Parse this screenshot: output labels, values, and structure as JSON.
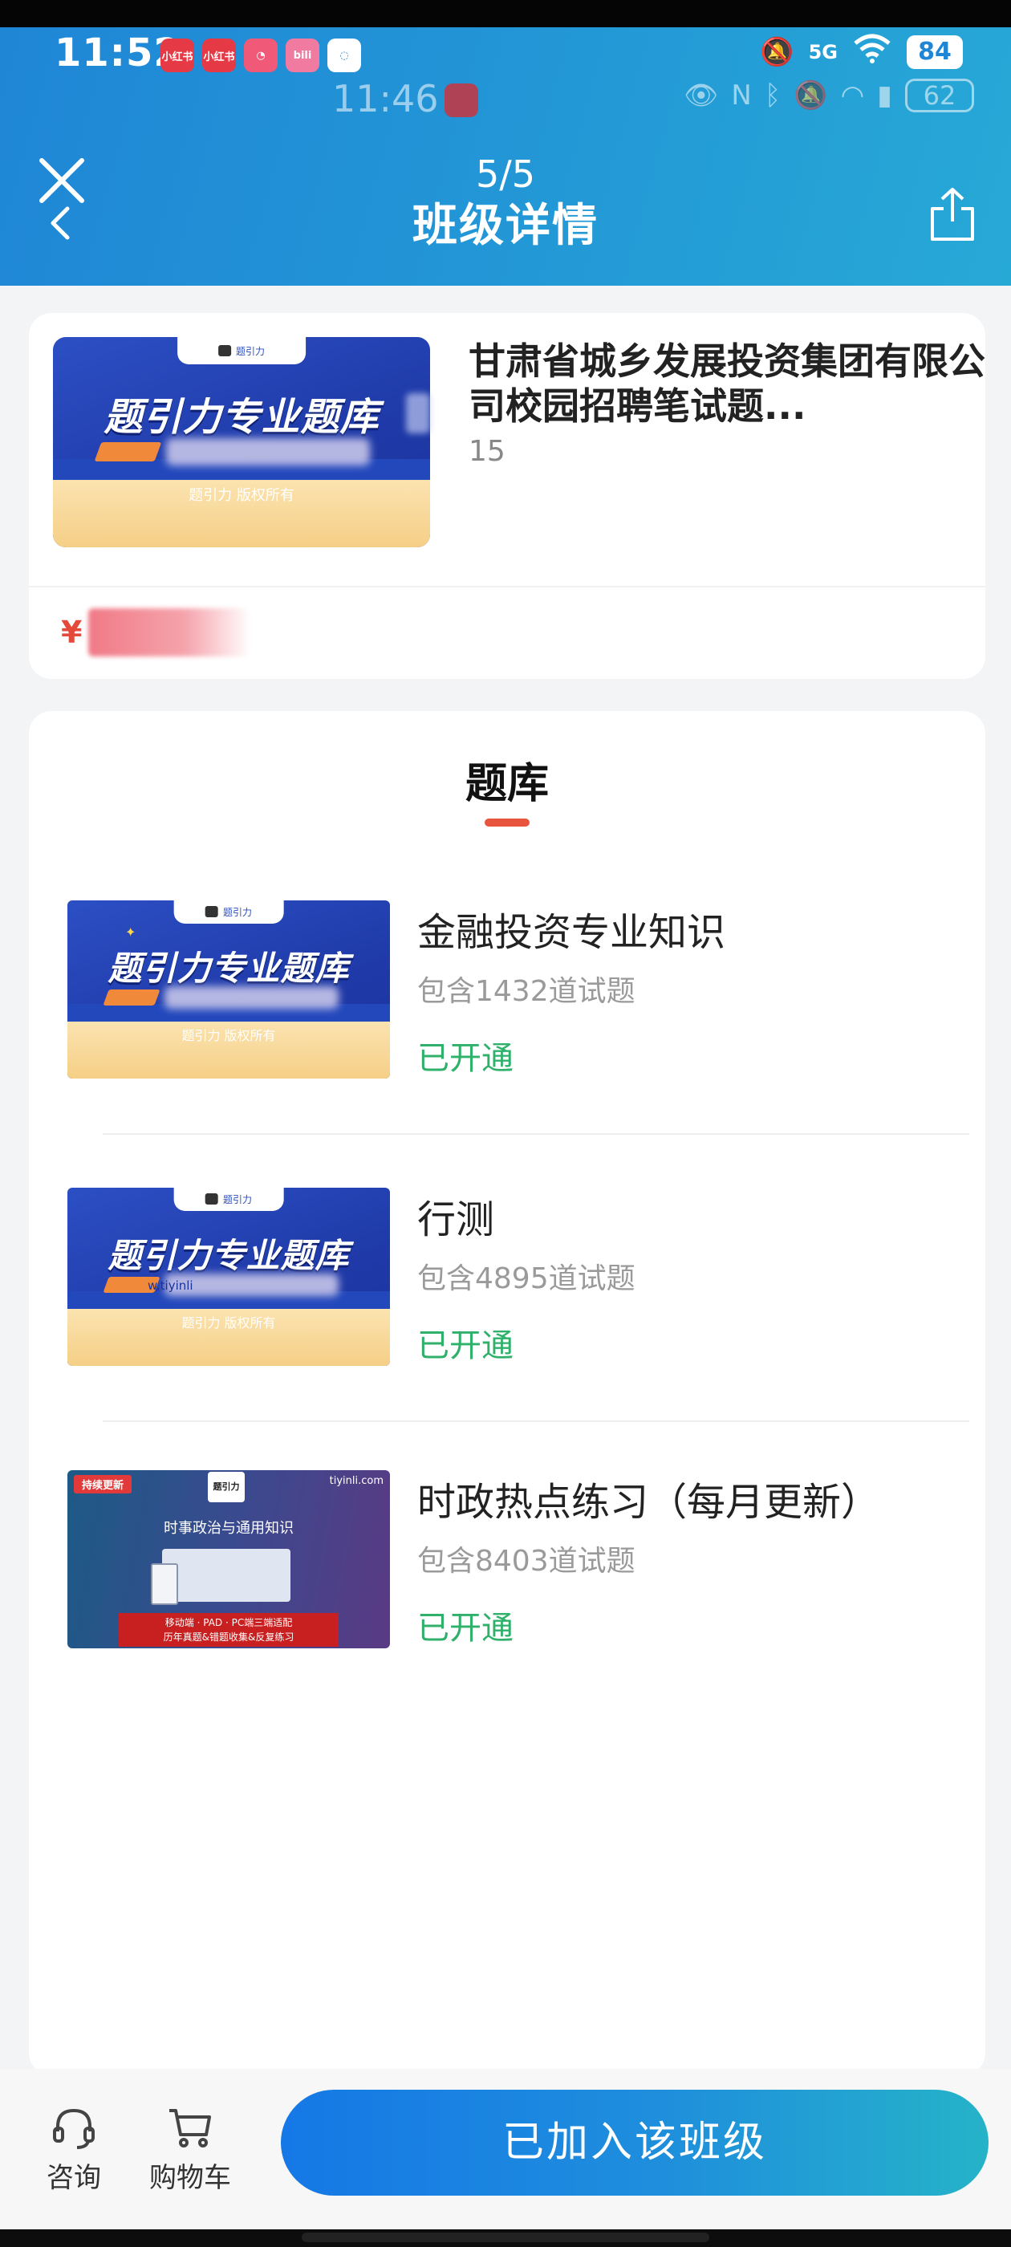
{
  "status_bar": {
    "time": "11:52",
    "battery": "84",
    "signal_label": "5G",
    "overlay_time": "11:46",
    "overlay_battery": "62",
    "app_icons": [
      {
        "label": "小红书",
        "color": "#e63946"
      },
      {
        "label": "小红书",
        "color": "#e63946"
      },
      {
        "label": "",
        "color": "#f05a78"
      },
      {
        "label": "bili",
        "color": "#f07aa0"
      },
      {
        "label": "",
        "color": "#ffffff"
      }
    ]
  },
  "nav": {
    "counter": "5/5",
    "title": "班级详情"
  },
  "product": {
    "title": "甘肃省城乡发展投资集团有限公司校园招聘笔试题...",
    "count": "15",
    "price_symbol": "¥",
    "thumb": {
      "title": "题引力专业题库",
      "caption": "题引力 版权所有",
      "tab": "题引力"
    }
  },
  "bank": {
    "heading": "题库",
    "items": [
      {
        "name": "金融投资专业知识",
        "count": "包含1432道试题",
        "status": "已开通",
        "thumb_type": "blue",
        "thumb_title": "题引力专业题库",
        "thumb_caption": "题引力 版权所有",
        "thumb_tab": "题引力"
      },
      {
        "name": "行测",
        "count": "包含4895道试题",
        "status": "已开通",
        "thumb_type": "blue",
        "thumb_title": "题引力专业题库",
        "thumb_caption": "题引力 版权所有",
        "thumb_tab": "题引力",
        "thumb_url": "w.tiyinli"
      },
      {
        "name": "时政热点练习（每月更新）",
        "count": "包含8403道试题",
        "status": "已开通",
        "thumb_type": "purple",
        "thumb_banner": "持续更新",
        "thumb_logo": "题引力",
        "thumb_url": "tiyinli.com",
        "thumb_sub": "时事政治与通用知识",
        "thumb_bar_line1": "移动端 · PAD · PC端三端适配",
        "thumb_bar_line2": "历年真题&错题收集&反复练习"
      }
    ]
  },
  "bottom": {
    "consult": "咨询",
    "cart": "购物车",
    "join": "已加入该班级"
  },
  "colors": {
    "header_gradient_start": "#1f86d6",
    "header_gradient_end": "#27a9d6",
    "status_open": "#2fb06b",
    "accent_underline": "#e8543e",
    "price": "#e34a3a"
  }
}
